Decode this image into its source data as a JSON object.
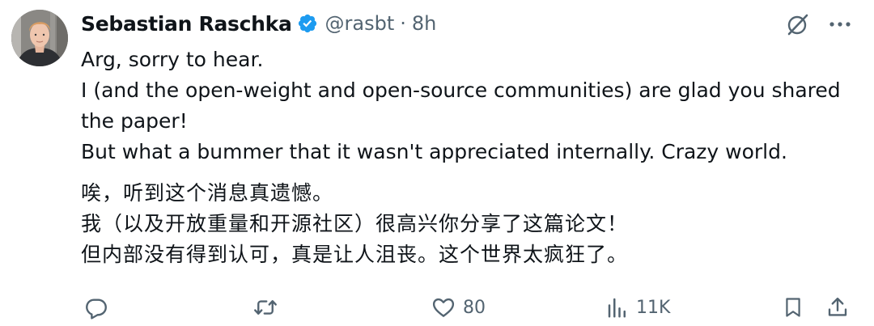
{
  "author": {
    "name": "Sebastian Raschka",
    "handle": "@rasbt",
    "separator": "·",
    "time": "8h",
    "verified_icon": "verified-badge-icon",
    "badge_color": "#1d9bf0"
  },
  "tweet": {
    "english": [
      "Arg, sorry to hear.",
      "I (and the open-weight and open-source communities) are glad you shared",
      "the paper!",
      "But what a bummer that it wasn't appreciated internally. Crazy world."
    ],
    "chinese": [
      "唉，听到这个消息真遗憾。",
      "我（以及开放重量和开源社区）很高兴你分享了这篇论文！",
      "但内部没有得到认可，真是让人沮丧。这个世界太疯狂了。"
    ]
  },
  "actions": {
    "reply": {
      "icon": "reply-icon"
    },
    "retweet": {
      "icon": "retweet-icon"
    },
    "like": {
      "icon": "heart-icon",
      "count": "80"
    },
    "views": {
      "icon": "views-chart-icon",
      "count": "11K"
    },
    "bookmark": {
      "icon": "bookmark-icon"
    },
    "share": {
      "icon": "share-icon"
    }
  },
  "top_right": {
    "grok": {
      "icon": "grok-icon"
    },
    "more": {
      "icon": "more-icon"
    }
  },
  "colors": {
    "text": "#0f1419",
    "muted": "#536471",
    "accent": "#1d9bf0",
    "background": "#ffffff"
  }
}
